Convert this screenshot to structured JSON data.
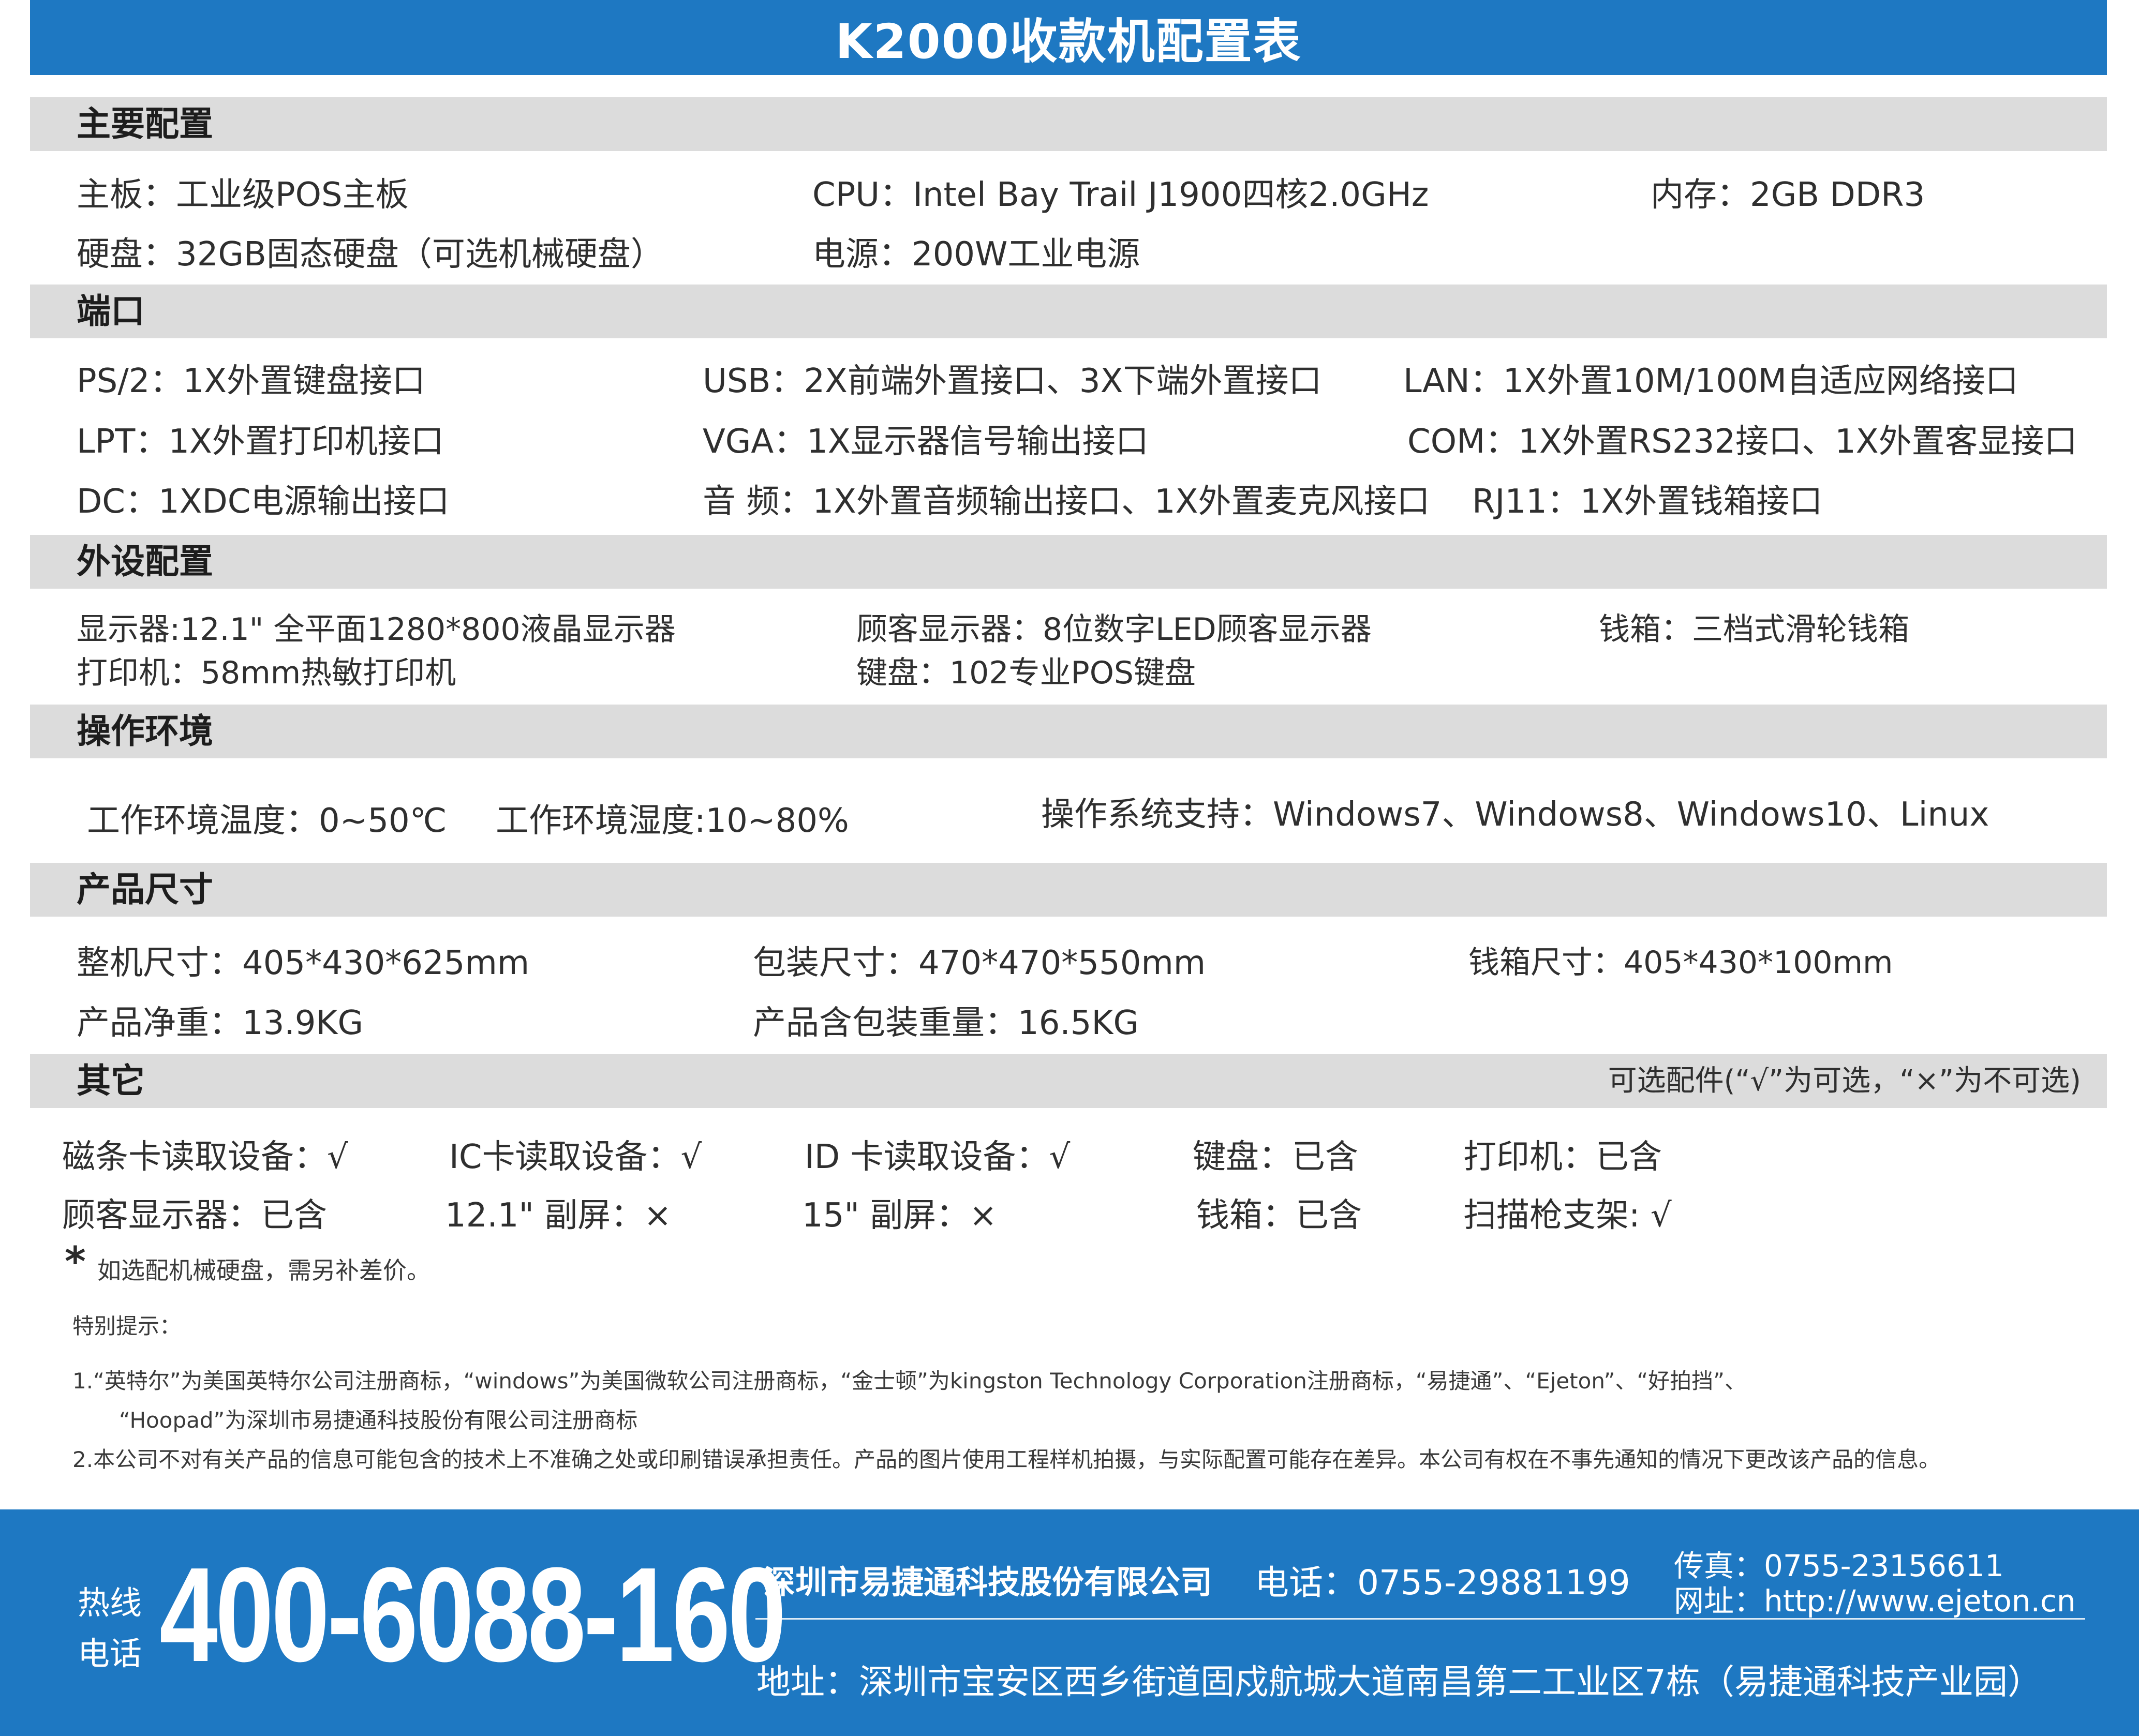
{
  "title": "K2000收款机配置表",
  "sections": {
    "main": {
      "title": "主要配置",
      "board": "主板：工业级POS主板",
      "cpu": "CPU：Intel Bay Trail J1900四核2.0GHz",
      "memory": "内存：2GB DDR3",
      "disk": "硬盘：32GB固态硬盘（可选机械硬盘）",
      "power": "电源：200W工业电源"
    },
    "ports": {
      "title": "端口",
      "ps2": "PS/2：1X外置键盘接口",
      "usb": "USB：2X前端外置接口、3X下端外置接口",
      "lan": "LAN：1X外置10M/100M自适应网络接口",
      "lpt": "LPT：1X外置打印机接口",
      "vga": "VGA：1X显示器信号输出接口",
      "com": "COM：1X外置RS232接口、1X外置客显接口",
      "dc": "DC：1XDC电源输出接口",
      "audio": "音 频：1X外置音频输出接口、1X外置麦克风接口",
      "rj11": "RJ11：1X外置钱箱接口"
    },
    "peripherals": {
      "title": "外设配置",
      "display": "显示器:12.1\" 全平面1280*800液晶显示器",
      "customer_display": "顾客显示器：8位数字LED顾客显示器",
      "cash_drawer": "钱箱：三档式滑轮钱箱",
      "printer": "打印机：58mm热敏打印机",
      "keyboard": "键盘：102专业POS键盘"
    },
    "environment": {
      "title": "操作环境",
      "temperature": "工作环境温度：0~50℃",
      "humidity": "工作环境湿度:10~80%",
      "os": "操作系统支持：Windows7、Windows8、Windows10、Linux"
    },
    "dimensions": {
      "title": "产品尺寸",
      "machine": "整机尺寸：405*430*625mm",
      "package": "包装尺寸：470*470*550mm",
      "drawer": "钱箱尺寸：405*430*100mm",
      "net_weight": "产品净重：13.9KG",
      "gross_weight": "产品含包装重量：16.5KG"
    },
    "other": {
      "title": "其它",
      "optional_note": "可选配件(“√”为可选，“×”为不可选)",
      "items_row1": [
        "磁条卡读取设备：√",
        "IC卡读取设备：√",
        "ID 卡读取设备：√",
        "键盘：已含",
        "打印机：已含"
      ],
      "items_row2": [
        "顾客显示器：已含",
        "12.1\" 副屏：×",
        "15\" 副屏：×",
        "钱箱：已含",
        "扫描枪支架: √"
      ]
    }
  },
  "notes": {
    "asterisk": "*",
    "hdd_note": "如选配机械硬盘，需另补差价。",
    "special_title": "特别提示：",
    "note1_line1": "1.“英特尔”为美国英特尔公司注册商标，“windows”为美国微软公司注册商标，“金士顿”为kingston Technology Corporation注册商标，“易捷通”、“Ejeton”、“好拍挡”、",
    "note1_line2": "“Hoopad”为深圳市易捷通科技股份有限公司注册商标",
    "note2": "2.本公司不对有关产品的信息可能包含的技术上不准确之处或印刷错误承担责任。产品的图片使用工程样机拍摄，与实际配置可能存在差异。本公司有权在不事先通知的情况下更改该产品的信息。"
  },
  "footer": {
    "hotline_label_1": "热线",
    "hotline_label_2": "电话",
    "hotline_number": "400-6088-160",
    "company": "深圳市易捷通科技股份有限公司",
    "phone": "电话：0755-29881199",
    "fax": "传真：0755-23156611",
    "website": "网址：http://www.ejeton.cn",
    "address": "地址：深圳市宝安区西乡街道固戍航城大道南昌第二工业区7栋（易捷通科技产业园）"
  },
  "colors": {
    "brand_blue": "#1e78c2",
    "section_gray": "#dcdcdc"
  }
}
